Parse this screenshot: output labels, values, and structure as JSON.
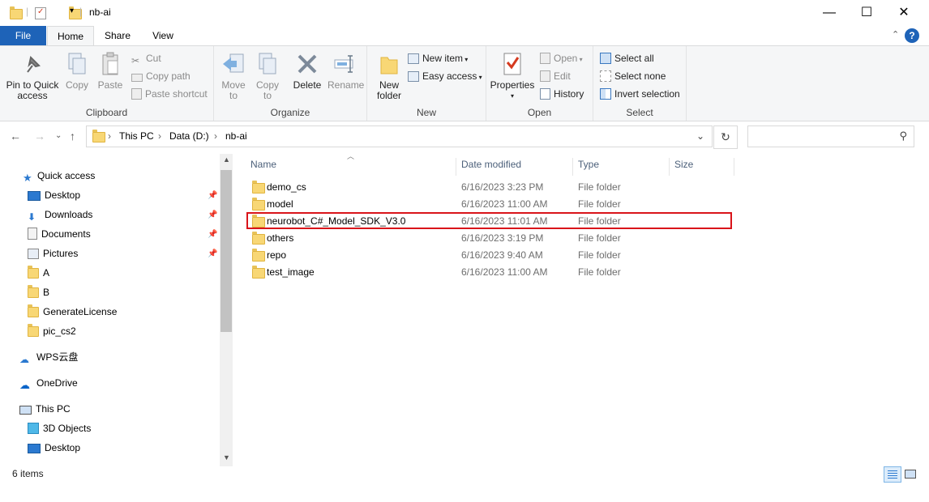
{
  "window": {
    "title": "nb-ai",
    "minimize": "—",
    "maximize": "☐",
    "close": "✕"
  },
  "tabs": {
    "file": "File",
    "home": "Home",
    "share": "Share",
    "view": "View"
  },
  "ribbon": {
    "clipboard": {
      "label": "Clipboard",
      "pin": "Pin to Quick access",
      "pin_line1": "Pin to Quick",
      "pin_line2": "access",
      "copy": "Copy",
      "paste": "Paste",
      "cut": "Cut",
      "copy_path": "Copy path",
      "paste_shortcut": "Paste shortcut"
    },
    "organize": {
      "label": "Organize",
      "move_to_line1": "Move",
      "move_to_line2": "to",
      "copy_to_line1": "Copy",
      "copy_to_line2": "to",
      "delete": "Delete",
      "rename": "Rename"
    },
    "new": {
      "label": "New",
      "new_folder_line1": "New",
      "new_folder_line2": "folder",
      "new_item": "New item",
      "easy_access": "Easy access"
    },
    "open": {
      "label": "Open",
      "properties": "Properties",
      "open": "Open",
      "edit": "Edit",
      "history": "History"
    },
    "select": {
      "label": "Select",
      "select_all": "Select all",
      "select_none": "Select none",
      "invert_selection": "Invert selection"
    }
  },
  "address": {
    "crumbs": [
      "This PC",
      "Data (D:)",
      "nb-ai"
    ],
    "search_placeholder": ""
  },
  "nav_pane": {
    "quick_access": "Quick access",
    "items": [
      {
        "label": "Desktop",
        "pinned": true
      },
      {
        "label": "Downloads",
        "pinned": true
      },
      {
        "label": "Documents",
        "pinned": true
      },
      {
        "label": "Pictures",
        "pinned": true
      },
      {
        "label": "A",
        "pinned": false
      },
      {
        "label": "B",
        "pinned": false
      },
      {
        "label": "GenerateLicense",
        "pinned": false
      },
      {
        "label": "pic_cs2",
        "pinned": false
      }
    ],
    "wps": "WPS云盘",
    "onedrive": "OneDrive",
    "this_pc": "This PC",
    "this_pc_items": [
      "3D Objects",
      "Desktop"
    ]
  },
  "columns": {
    "name": "Name",
    "date": "Date modified",
    "type": "Type",
    "size": "Size"
  },
  "files": [
    {
      "name": "demo_cs",
      "date": "6/16/2023 3:23 PM",
      "type": "File folder"
    },
    {
      "name": "model",
      "date": "6/16/2023 11:00 AM",
      "type": "File folder"
    },
    {
      "name": "neurobot_C#_Model_SDK_V3.0",
      "date": "6/16/2023 11:01 AM",
      "type": "File folder"
    },
    {
      "name": "others",
      "date": "6/16/2023 3:19 PM",
      "type": "File folder"
    },
    {
      "name": "repo",
      "date": "6/16/2023 9:40 AM",
      "type": "File folder"
    },
    {
      "name": "test_image",
      "date": "6/16/2023 11:00 AM",
      "type": "File folder"
    }
  ],
  "highlighted_file": "neurobot_C#_Model_SDK_V3.0",
  "status": "6 items",
  "colors": {
    "file_tab": "#1e63b8",
    "highlight": "#d9141a",
    "folder": "#f8d775"
  }
}
